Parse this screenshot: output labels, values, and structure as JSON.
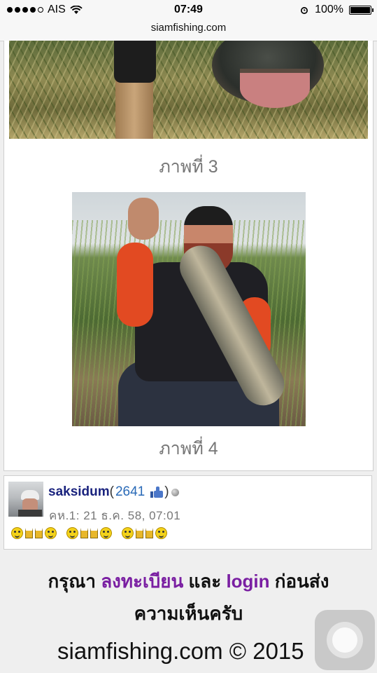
{
  "status_bar": {
    "carrier": "AIS",
    "time": "07:49",
    "battery": "100%",
    "icons": [
      "signal-dots-icon",
      "wifi-icon",
      "alarm-icon",
      "battery-icon"
    ]
  },
  "browser": {
    "url": "siamfishing.com"
  },
  "post": {
    "captions": [
      "ภาพที่ 3",
      "ภาพที่ 4"
    ]
  },
  "comment": {
    "username": "saksidum",
    "open_paren": "(",
    "points": "2641",
    "close_paren": ")",
    "meta": "คห.1: 21 ธ.ค. 58, 07:01",
    "emoticons": [
      "smile-beer-smile",
      "smile-beer-smile",
      "smile-beer-smile"
    ]
  },
  "footer": {
    "note_prefix": "กรุณา ",
    "register_link": "ลงทะเบียน",
    "note_and": " และ ",
    "login_link": "login",
    "note_suffix": " ก่อนส่ง",
    "note_line2": "ความเห็นครับ",
    "copyright": "siamfishing.com © 2015"
  },
  "colors": {
    "username": "#1a237e",
    "points": "#2a6ab7",
    "link": "#7a1fa2",
    "caption": "#777777"
  }
}
